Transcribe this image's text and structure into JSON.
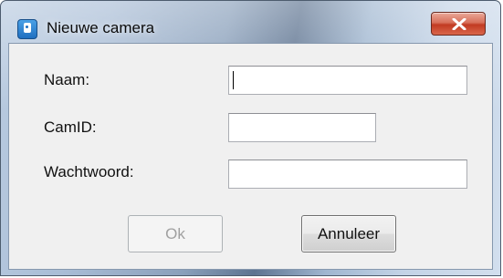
{
  "window": {
    "title": "Nieuwe camera",
    "icon": "camera-app-icon",
    "close_icon": "close-icon"
  },
  "form": {
    "name_label": "Naam:",
    "name_value": "",
    "camid_label": "CamID:",
    "camid_value": "",
    "password_label": "Wachtwoord:",
    "password_value": ""
  },
  "buttons": {
    "ok_label": "Ok",
    "ok_enabled": false,
    "cancel_label": "Annuleer"
  },
  "colors": {
    "close_button": "#c23b22",
    "client_background": "#f0f0f0"
  }
}
